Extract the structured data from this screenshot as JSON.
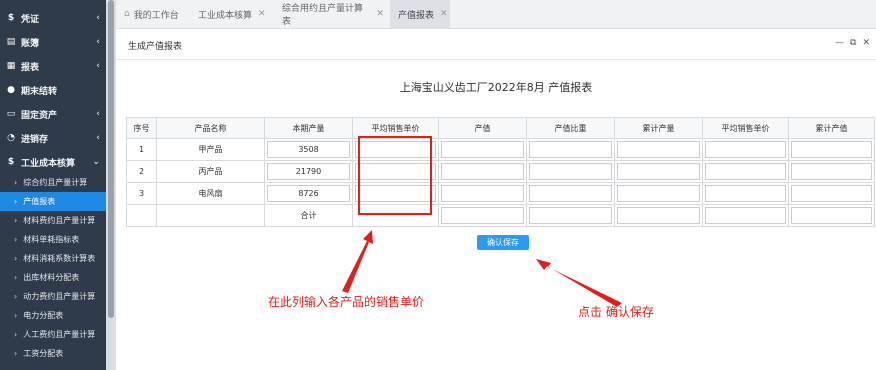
{
  "sidebar": {
    "items": [
      {
        "icon": "$",
        "label": "凭证",
        "chevron": "‹"
      },
      {
        "icon": "▤",
        "label": "账簿",
        "chevron": "‹"
      },
      {
        "icon": "▦",
        "label": "报表",
        "chevron": "‹"
      },
      {
        "icon": "●",
        "label": "期末结转",
        "chevron": ""
      },
      {
        "icon": "▭",
        "label": "固定资产",
        "chevron": "‹"
      },
      {
        "icon": "◔",
        "label": "进销存",
        "chevron": "‹"
      },
      {
        "icon": "$",
        "label": "工业成本核算",
        "chevron": "⌄"
      }
    ],
    "sub_items": [
      {
        "label": "综合约且产量计算",
        "active": false
      },
      {
        "label": "产值报表",
        "active": true
      },
      {
        "label": "材料费约且产量计算",
        "active": false
      },
      {
        "label": "材料单耗指标表",
        "active": false
      },
      {
        "label": "材料消耗系数计算表",
        "active": false
      },
      {
        "label": "出库材料分配表",
        "active": false
      },
      {
        "label": "动力费约且产量计算",
        "active": false
      },
      {
        "label": "电力分配表",
        "active": false
      },
      {
        "label": "人工费约且产量计算",
        "active": false
      },
      {
        "label": "工资分配表",
        "active": false
      }
    ]
  },
  "tabs": [
    {
      "label": "我的工作台",
      "closable": false
    },
    {
      "label": "工业成本核算",
      "closable": true
    },
    {
      "label": "综合用约且产量计算表",
      "closable": true
    },
    {
      "label": "产值报表",
      "closable": true
    }
  ],
  "panel": {
    "title": "生成产值报表",
    "tools": [
      "—",
      "⧉",
      "✕"
    ]
  },
  "report": {
    "title": "上海宝山义齿工厂2022年8月 产值报表",
    "columns": [
      "序号",
      "产品名称",
      "本期产量",
      "平均销售单价",
      "产值",
      "产值比重",
      "累计产量",
      "平均销售单价",
      "累计产值"
    ],
    "rows": [
      {
        "no": "1",
        "name": "甲产品",
        "qty": "3508"
      },
      {
        "no": "2",
        "name": "丙产品",
        "qty": "21790"
      },
      {
        "no": "3",
        "name": "电风扇",
        "qty": "8726"
      }
    ],
    "total_label": "合计",
    "save_label": "确认保存"
  },
  "annotations": {
    "left_note": "在此列输入各产品的销售单价",
    "right_note": "点击  确认保存",
    "color": "#e0201a"
  }
}
